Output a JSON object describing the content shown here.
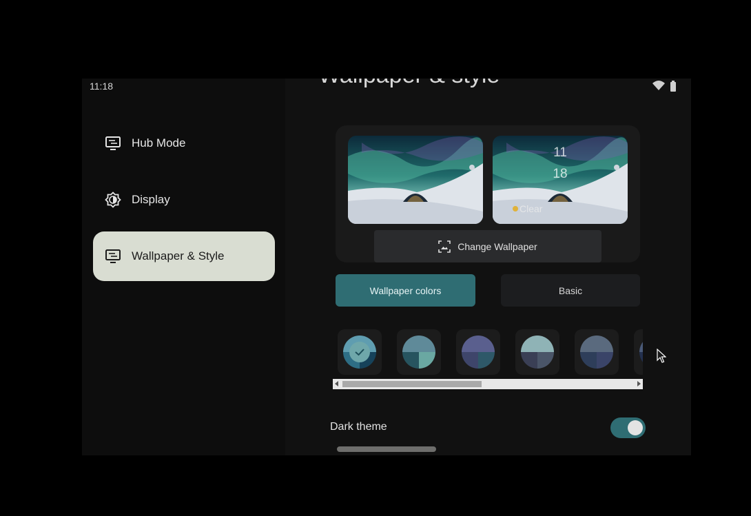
{
  "status_bar": {
    "time": "11:18"
  },
  "sidebar": {
    "items": [
      {
        "label": "Hub Mode",
        "icon": "hub-mode-icon",
        "active": false
      },
      {
        "label": "Display",
        "icon": "brightness-icon",
        "active": false
      },
      {
        "label": "Wallpaper & Style",
        "icon": "wallpaper-icon",
        "active": true
      }
    ]
  },
  "main": {
    "title": "Wallpaper & style",
    "preview": {
      "lock_hour": "11",
      "lock_minute": "18",
      "weather": "Clear"
    },
    "change_wallpaper_label": "Change Wallpaper",
    "tabs": [
      {
        "label": "Wallpaper colors",
        "selected": true
      },
      {
        "label": "Basic",
        "selected": false
      }
    ],
    "color_options": [
      {
        "top": "#5f9db0",
        "bl": "#2e6e85",
        "br": "#16425a",
        "selected": true
      },
      {
        "top": "#5f8a99",
        "bl": "#27545f",
        "br": "#6aa8a2",
        "selected": false
      },
      {
        "top": "#5a5f8e",
        "bl": "#3e456a",
        "br": "#2e5868",
        "selected": false
      },
      {
        "top": "#8fb3b6",
        "bl": "#3a3f55",
        "br": "#4a5568",
        "selected": false
      },
      {
        "top": "#5a6a7e",
        "bl": "#2e3e5a",
        "br": "#3a4468",
        "selected": false
      },
      {
        "top": "#4a5a78",
        "bl": "#23304e",
        "br": "#304060",
        "selected": false
      }
    ],
    "dark_theme_label": "Dark theme",
    "dark_theme_on": true
  },
  "colors": {
    "accent": "#2f6d73",
    "active_nav": "#d9ddd2"
  }
}
